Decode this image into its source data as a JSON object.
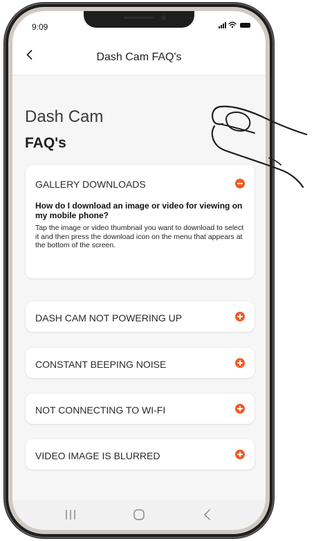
{
  "status_bar": {
    "time": "9:09"
  },
  "header": {
    "title": "Dash Cam FAQ's"
  },
  "page": {
    "heading_line1": "Dash Cam",
    "heading_line2": "FAQ's"
  },
  "faq": {
    "expanded": {
      "title": "GALLERY DOWNLOADS",
      "question": "How do I download an image or video for viewing on my mobile phone?",
      "answer": "Tap the image or video thumbnail you want to download to select it and then press the download icon on the menu that appears at the bottom of the screen."
    },
    "items": [
      {
        "title": "DASH CAM NOT POWERING UP"
      },
      {
        "title": "CONSTANT BEEPING NOISE"
      },
      {
        "title": "NOT CONNECTING TO WI-FI"
      },
      {
        "title": "VIDEO IMAGE IS BLURRED"
      }
    ]
  },
  "icons": {
    "back": "chevron-left-icon",
    "expanded_toggle": "minus-icon",
    "collapsed_toggle": "plus-icon",
    "recents": "recents-icon",
    "home": "home-icon",
    "nav_back": "nav-back-icon"
  },
  "colors": {
    "accent": "#f25a23",
    "content_background": "#f6f6f6",
    "card_background": "#ffffff",
    "text_primary": "#1f1f1f"
  }
}
